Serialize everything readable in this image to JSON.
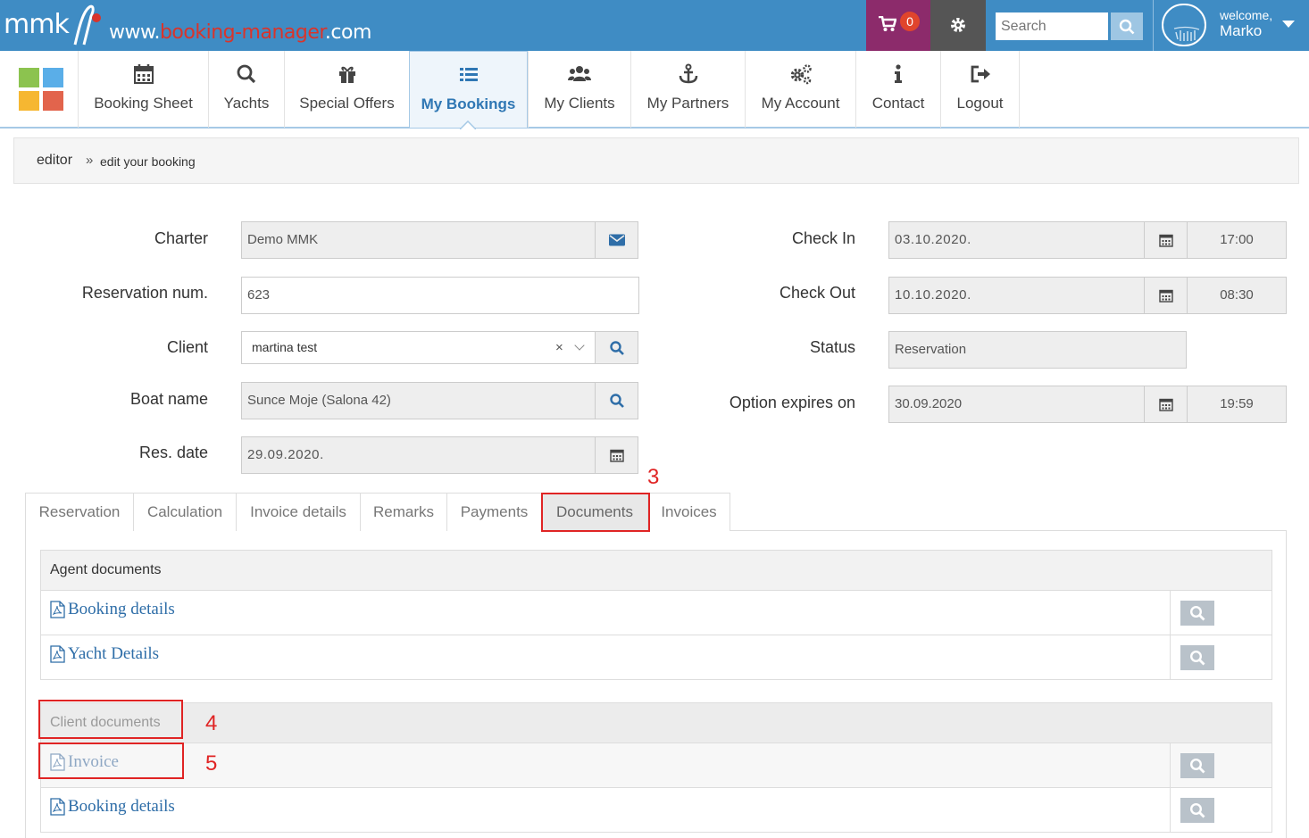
{
  "topbar": {
    "logo_text": "mmk",
    "site_url_prefix": "www.",
    "site_url_mid": "booking-manager",
    "site_url_suffix": ".com",
    "cart_count": "0",
    "search_placeholder": "Search",
    "welcome": "welcome,",
    "username": "Marko"
  },
  "nav": {
    "items": [
      {
        "label": "Booking Sheet",
        "icon": "calendar-icon"
      },
      {
        "label": "Yachts",
        "icon": "search-icon"
      },
      {
        "label": "Special Offers",
        "icon": "gift-icon"
      },
      {
        "label": "My Bookings",
        "icon": "list-icon",
        "active": true
      },
      {
        "label": "My Clients",
        "icon": "users-icon"
      },
      {
        "label": "My Partners",
        "icon": "anchor-icon"
      },
      {
        "label": "My Account",
        "icon": "gears-icon"
      },
      {
        "label": "Contact",
        "icon": "info-icon"
      },
      {
        "label": "Logout",
        "icon": "logout-icon"
      }
    ]
  },
  "breadcrumb": {
    "root": "editor",
    "separator": "»",
    "current": "edit your booking"
  },
  "form": {
    "charter_label": "Charter",
    "charter_value": "Demo MMK",
    "reservation_num_label": "Reservation num.",
    "reservation_num_value": "623",
    "client_label": "Client",
    "client_value": "martina test",
    "client_clear": "×",
    "boat_name_label": "Boat name",
    "boat_name_value": "Sunce Moje (Salona 42)",
    "res_date_label": "Res. date",
    "res_date_value": "29.09.2020.",
    "check_in_label": "Check In",
    "check_in_date": "03.10.2020.",
    "check_in_time": "17:00",
    "check_out_label": "Check Out",
    "check_out_date": "10.10.2020.",
    "check_out_time": "08:30",
    "status_label": "Status",
    "status_value": "Reservation",
    "option_label": "Option expires on",
    "option_date": "30.09.2020",
    "option_time": "19:59"
  },
  "tabs": [
    "Reservation",
    "Calculation",
    "Invoice details",
    "Remarks",
    "Payments",
    "Documents",
    "Invoices"
  ],
  "active_tab": "Documents",
  "agent_documents": {
    "title": "Agent documents",
    "rows": [
      "Booking details",
      "Yacht Details"
    ]
  },
  "client_documents": {
    "title": "Client documents",
    "rows": [
      "Invoice",
      "Booking details"
    ]
  },
  "annotations": {
    "step_tab": "3",
    "step_client_docs": "4",
    "step_invoice": "5"
  },
  "colors": {
    "topbar": "#3f8cc4",
    "cart": "#8c2b6b",
    "accent_link": "#2f6ea8",
    "annotation": "#e02424"
  }
}
